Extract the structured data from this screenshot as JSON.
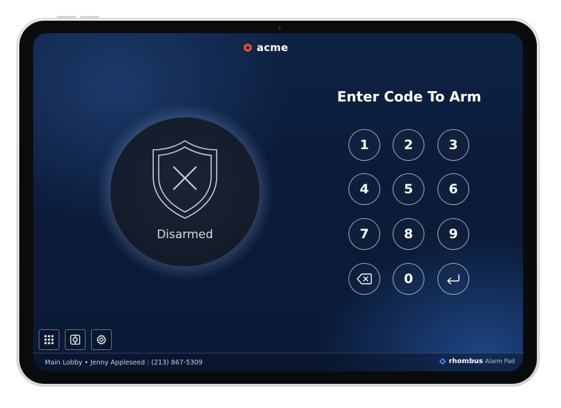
{
  "header": {
    "brand_name": "acme",
    "brand_color": "#e8542a"
  },
  "status": {
    "label": "Disarmed",
    "icon": "shield-x-icon"
  },
  "keypad": {
    "title": "Enter Code To Arm",
    "keys": [
      "1",
      "2",
      "3",
      "4",
      "5",
      "6",
      "7",
      "8",
      "9",
      "0"
    ],
    "backspace_icon": "backspace-icon",
    "enter_icon": "enter-icon"
  },
  "toolbar": {
    "buttons": [
      {
        "icon": "keypad-grid-icon"
      },
      {
        "icon": "camera-view-icon"
      },
      {
        "icon": "gear-icon"
      }
    ]
  },
  "footer": {
    "location_info": "Main Lobby • Jenny Appleseed : (213) 867-5309",
    "product_name": "rhombus",
    "product_sub": "Alarm Pad",
    "product_color": "#3d8bff"
  }
}
